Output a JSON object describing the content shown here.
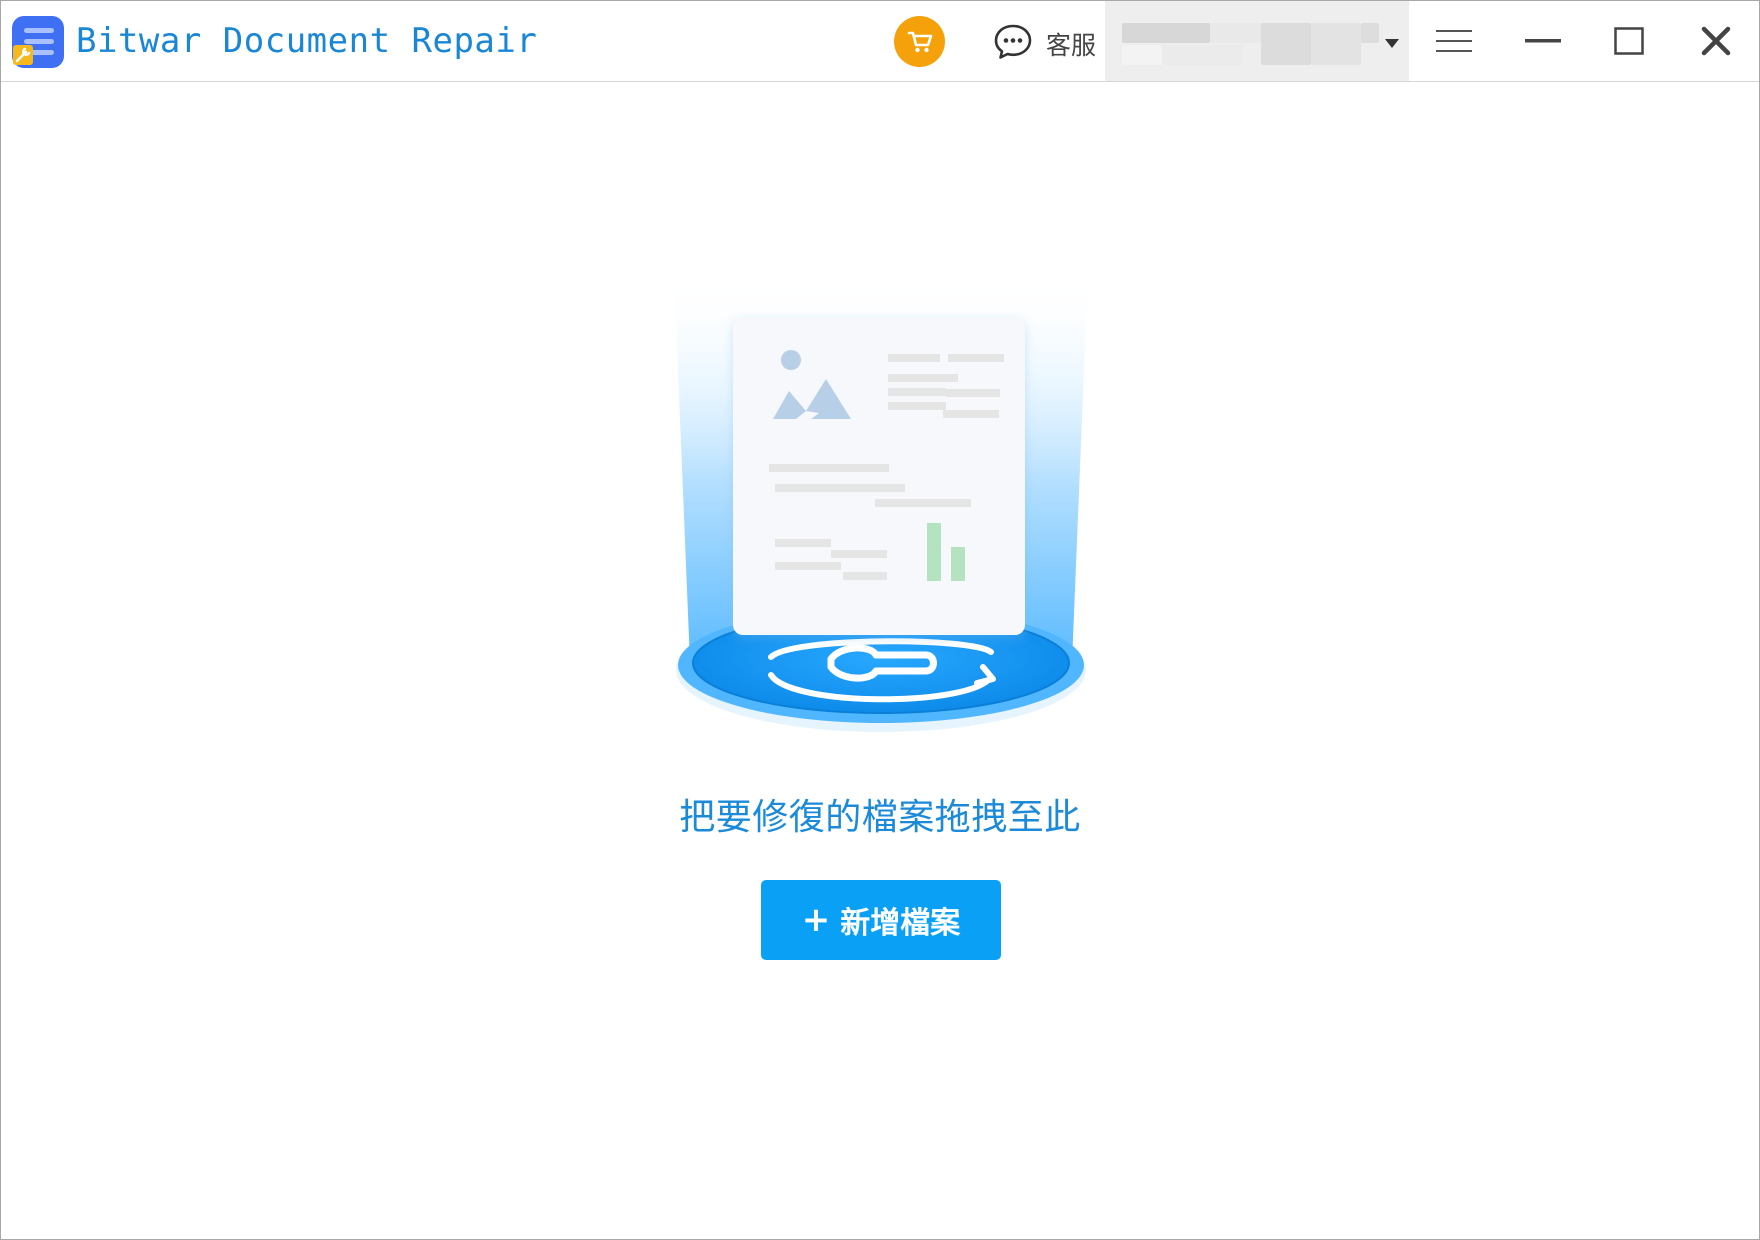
{
  "window": {
    "title": "Bitwar Document Repair"
  },
  "header": {
    "logo_icon": "document-repair-logo-icon",
    "cart_icon": "shopping-cart-icon",
    "support": {
      "icon": "chat-bubble-icon",
      "label": "客服"
    },
    "account": {
      "dropdown_icon": "caret-down-icon"
    },
    "menu_icon": "hamburger-menu-icon",
    "minimize_icon": "minimize-icon",
    "maximize_icon": "maximize-icon",
    "close_icon": "close-icon"
  },
  "main": {
    "illustration": "document-repair-illustration",
    "drop_hint": "把要修復的檔案拖拽至此",
    "add_button": {
      "icon": "plus-icon",
      "label": "新增檔案"
    }
  },
  "colors": {
    "title": "#1a86d6",
    "accent": "#0aa0f5",
    "cart": "#f4a10c",
    "hint": "#1a8ad9"
  }
}
